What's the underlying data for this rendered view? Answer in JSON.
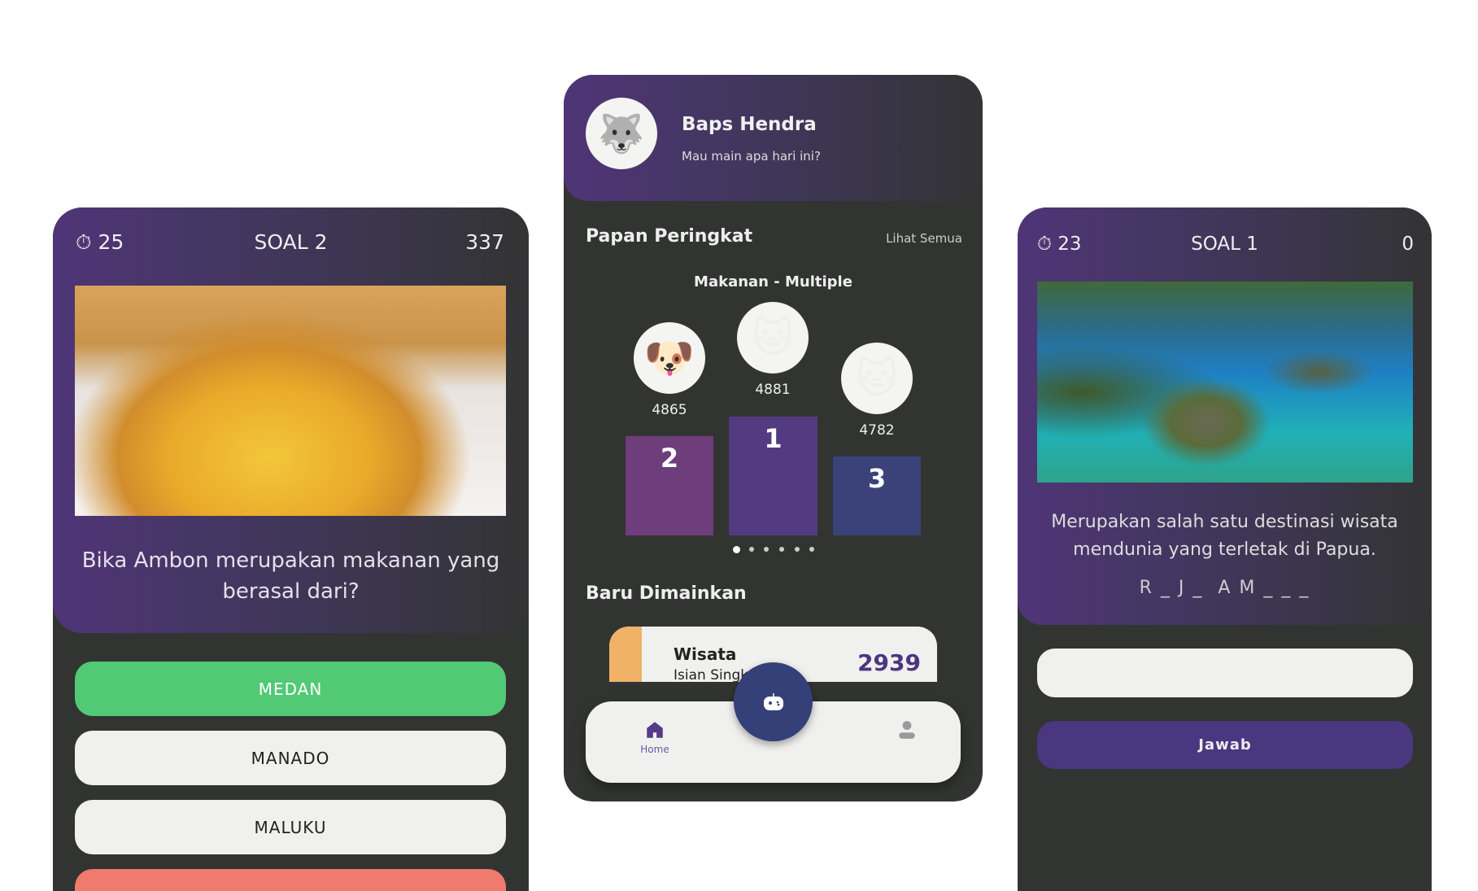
{
  "left_screen": {
    "timer": "25",
    "title": "SOAL 2",
    "score": "337",
    "question": "Bika Ambon merupakan makanan yang berasal dari?",
    "options": [
      "MEDAN",
      "MANADO",
      "MALUKU"
    ],
    "colors": {
      "correct": "#52c975",
      "wrong": "#ef7a6e"
    }
  },
  "center_screen": {
    "user_name": "Baps Hendra",
    "greeting": "Mau main apa hari ini?",
    "leaderboard_title": "Papan Peringkat",
    "see_all": "Lihat Semua",
    "category": "Makanan - Multiple",
    "podium": [
      {
        "rank": "2",
        "score": "4865"
      },
      {
        "rank": "1",
        "score": "4881"
      },
      {
        "rank": "3",
        "score": "4782"
      }
    ],
    "recent_title": "Baru Dimainkan",
    "recent_item": {
      "title": "Wisata",
      "subtitle": "Isian Singkat",
      "score": "2939"
    },
    "nav": {
      "home": "Home",
      "profile": "Profile"
    }
  },
  "right_screen": {
    "timer": "23",
    "title": "SOAL 1",
    "score": "0",
    "question": "Merupakan salah satu destinasi wisata mendunia yang terletak di Papua.",
    "hint": "R _ J _  A M _ _ _",
    "answer_value": "",
    "submit": "Jawab"
  }
}
